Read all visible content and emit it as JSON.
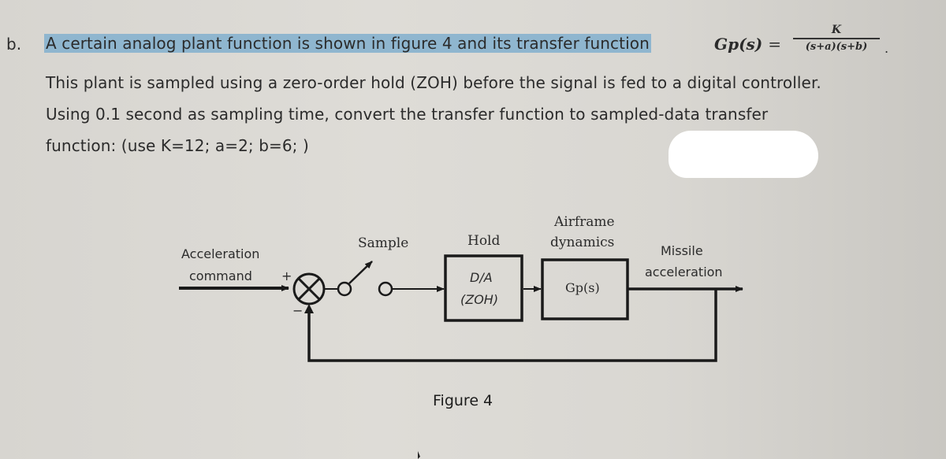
{
  "question": {
    "label": "b.",
    "highlighted_text": "A certain analog plant function is shown in figure 4 and its transfer function",
    "formula": {
      "lhs": "Gp(s)",
      "equals": "=",
      "numerator": "K",
      "denominator": "(s+a)(s+b)",
      "trailing": "."
    },
    "line2": "This plant is sampled using a zero-order hold (ZOH) before the signal is fed to a digital controller.",
    "line3": "Using 0.1 second as sampling time, convert the transfer function to sampled-data transfer",
    "line4": "function: (use K=12; a=2; b=6; )"
  },
  "diagram": {
    "input_label_line1": "Acceleration",
    "input_label_line2": "command",
    "plus_sign": "+",
    "minus_sign": "−",
    "sample_label": "Sample",
    "hold_label": "Hold",
    "hold_block_line1": "D/A",
    "hold_block_line2": "(ZOH)",
    "plant_label_line1": "Airframe",
    "plant_label_line2": "dynamics",
    "plant_block": "Gp(s)",
    "output_label_line1": "Missile",
    "output_label_line2": "acceleration",
    "caption": "Figure 4"
  },
  "colors": {
    "highlight": "#8fb6cf",
    "ink": "#1a1a1a"
  }
}
